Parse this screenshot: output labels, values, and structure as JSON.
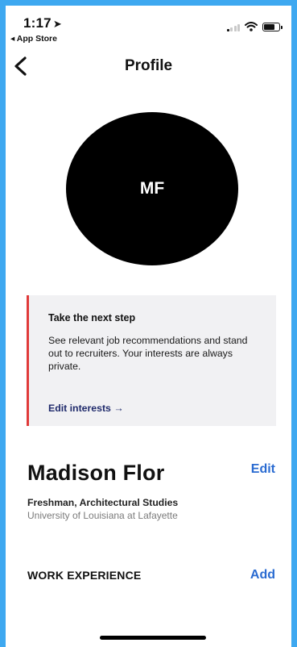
{
  "status_bar": {
    "time": "1:17",
    "back_label": "◂ App Store"
  },
  "nav": {
    "title": "Profile"
  },
  "avatar": {
    "initials": "MF"
  },
  "card": {
    "title": "Take the next step",
    "body": "See relevant job recommendations and stand out to recruiters. Your interests are always private.",
    "link": "Edit interests →",
    "accent_color": "#e03a3a"
  },
  "profile": {
    "name": "Madison Flor",
    "edit_label": "Edit",
    "subtitle": "Freshman, Architectural Studies",
    "school": "University of Louisiana at Lafayette"
  },
  "work_experience": {
    "title": "WORK EXPERIENCE",
    "add_label": "Add"
  },
  "icons": [
    "location-arrow-icon",
    "signal-icon",
    "wifi-icon",
    "battery-icon",
    "back-chevron-icon"
  ],
  "colors": {
    "frame": "#3ea8f0",
    "link_blue": "#2a6bd1",
    "card_bg": "#f1f1f3"
  }
}
